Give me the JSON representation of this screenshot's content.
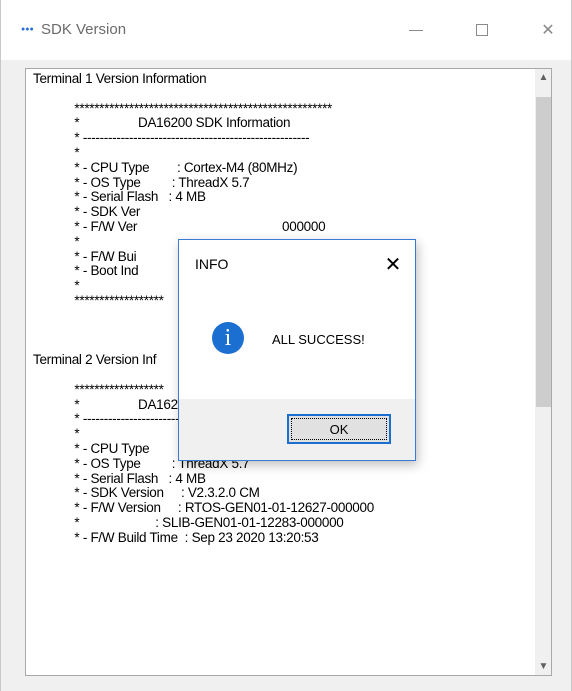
{
  "window": {
    "title": "SDK Version",
    "icon_text": "●●●",
    "controls": {
      "minimize": "",
      "maximize": "",
      "close": "✕"
    }
  },
  "textbox": {
    "lines": [
      "Terminal 1 Version Information",
      "",
      "            ****************************************************",
      "            *                 DA16200 SDK Information",
      "            * ------------------------------------------------------",
      "            *",
      "            * - CPU Type        : Cortex-M4 (80MHz)",
      "            * - OS Type         : ThreadX 5.7",
      "            * - Serial Flash   : 4 MB",
      "            * - SDK Ver",
      "            * - F/W Ver                                          000000",
      "            *",
      "            * - F/W Bui",
      "            * - Boot Ind",
      "            *",
      "            ******************",
      "",
      "",
      "",
      "Terminal 2 Version Inf",
      "",
      "            ******************",
      "            *                 DA16200 SDK Information",
      "            * ------------------------------------------------------",
      "            *",
      "            * - CPU Type        : Cortex-M4 (80MHz)",
      "            * - OS Type         : ThreadX 5.7",
      "            * - Serial Flash   : 4 MB",
      "            * - SDK Version     : V2.3.2.0 CM",
      "            * - F/W Version     : RTOS-GEN01-01-12627-000000",
      "            *                      : SLIB-GEN01-01-12283-000000",
      "            * - F/W Build Time  : Sep 23 2020 13:20:53"
    ],
    "scroll_up": "▲",
    "scroll_down": "▼"
  },
  "dialog": {
    "title": "INFO",
    "close": "✕",
    "icon": "i",
    "message": "ALL SUCCESS!",
    "ok_label": "OK"
  },
  "colors": {
    "accent": "#1a6fd1",
    "window_bg": "#f0f0f0"
  }
}
